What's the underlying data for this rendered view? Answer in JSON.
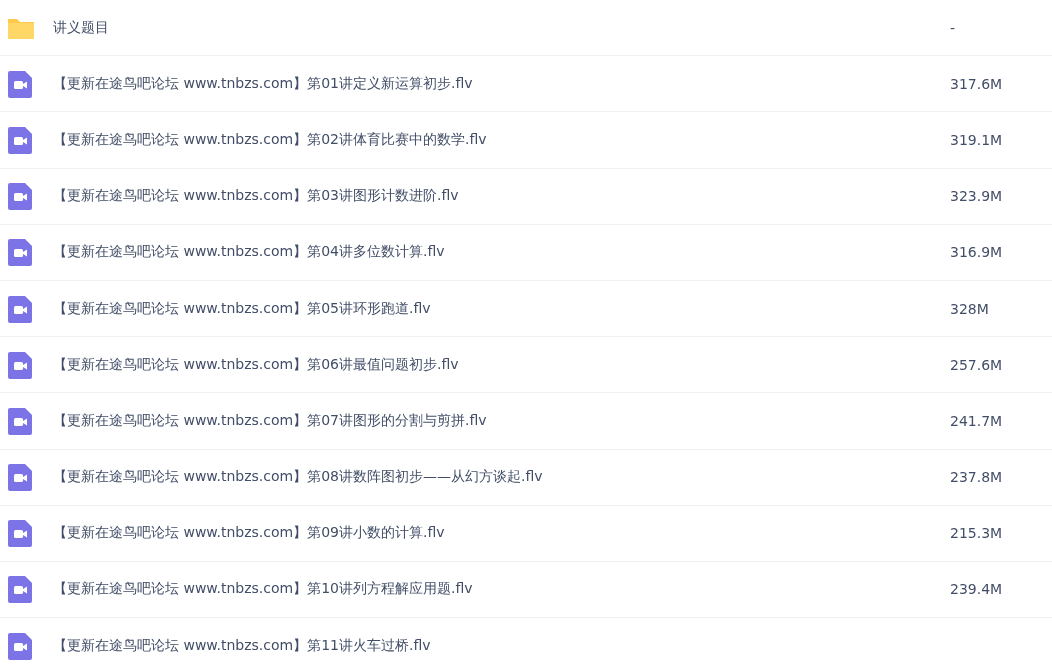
{
  "files": [
    {
      "kind": "folder",
      "name": "讲义题目",
      "size": "-"
    },
    {
      "kind": "video",
      "name": "【更新在途鸟吧论坛 www.tnbzs.com】第01讲定义新运算初步.flv",
      "size": "317.6M"
    },
    {
      "kind": "video",
      "name": "【更新在途鸟吧论坛 www.tnbzs.com】第02讲体育比赛中的数学.flv",
      "size": "319.1M"
    },
    {
      "kind": "video",
      "name": "【更新在途鸟吧论坛 www.tnbzs.com】第03讲图形计数进阶.flv",
      "size": "323.9M"
    },
    {
      "kind": "video",
      "name": "【更新在途鸟吧论坛 www.tnbzs.com】第04讲多位数计算.flv",
      "size": "316.9M"
    },
    {
      "kind": "video",
      "name": "【更新在途鸟吧论坛 www.tnbzs.com】第05讲环形跑道.flv",
      "size": "328M"
    },
    {
      "kind": "video",
      "name": "【更新在途鸟吧论坛 www.tnbzs.com】第06讲最值问题初步.flv",
      "size": "257.6M"
    },
    {
      "kind": "video",
      "name": "【更新在途鸟吧论坛 www.tnbzs.com】第07讲图形的分割与剪拼.flv",
      "size": "241.7M"
    },
    {
      "kind": "video",
      "name": "【更新在途鸟吧论坛 www.tnbzs.com】第08讲数阵图初步——从幻方谈起.flv",
      "size": "237.8M"
    },
    {
      "kind": "video",
      "name": "【更新在途鸟吧论坛 www.tnbzs.com】第09讲小数的计算.flv",
      "size": "215.3M"
    },
    {
      "kind": "video",
      "name": "【更新在途鸟吧论坛 www.tnbzs.com】第10讲列方程解应用题.flv",
      "size": "239.4M"
    },
    {
      "kind": "video",
      "name": "【更新在途鸟吧论坛 www.tnbzs.com】第11讲火车过桥.flv"
    }
  ]
}
